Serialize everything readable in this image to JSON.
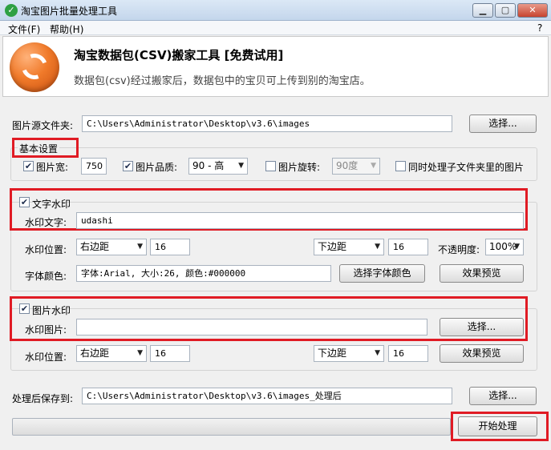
{
  "window": {
    "title": "淘宝图片批量处理工具",
    "app_icon": "check-icon",
    "controls": {
      "help": "?"
    }
  },
  "menu": [
    "文件(F)",
    "帮助(H)"
  ],
  "banner": {
    "title": "淘宝数据包(CSV)搬家工具 [免费试用]",
    "subtitle": "数据包(csv)经过搬家后，数据包中的宝贝可上传到别的淘宝店。"
  },
  "source_folder": {
    "label": "图片源文件夹:",
    "value": "C:\\Users\\Administrator\\Desktop\\v3.6\\images",
    "button": "选择..."
  },
  "basic": {
    "label": "基本设置",
    "width_label": "图片宽:",
    "width_checked": true,
    "width_value": "750",
    "quality_label": "图片品质:",
    "quality_checked": true,
    "quality_value": "90 - 高",
    "rotate_label": "图片旋转:",
    "rotate_checked": false,
    "rotate_value": "90度",
    "subfolder_label": "同时处理子文件夹里的图片",
    "subfolder_checked": false
  },
  "text_watermark": {
    "label": "文字水印",
    "checked": true,
    "text_label": "水印文字:",
    "text_value": "udashi",
    "position_label": "水印位置:",
    "h_position": "右边距",
    "h_offset": "16",
    "v_position": "下边距",
    "v_offset": "16",
    "opacity_label": "不透明度:",
    "opacity_value": "100%",
    "font_label": "字体颜色:",
    "font_value": "字体:Arial, 大小:26, 颜色:#000000",
    "font_button": "选择字体颜色",
    "preview_button": "效果预览"
  },
  "image_watermark": {
    "label": "图片水印",
    "checked": true,
    "image_label": "水印图片:",
    "image_value": "",
    "choose_button": "选择...",
    "position_label": "水印位置:",
    "h_position": "右边距",
    "h_offset": "16",
    "v_position": "下边距",
    "v_offset": "16",
    "preview_button": "效果预览"
  },
  "output": {
    "label": "处理后保存到:",
    "value": "C:\\Users\\Administrator\\Desktop\\v3.6\\images_处理后",
    "button": "选择..."
  },
  "start_button": "开始处理",
  "colors": {
    "highlight": "#e01b24",
    "title_bar": "#c4d6ec"
  }
}
